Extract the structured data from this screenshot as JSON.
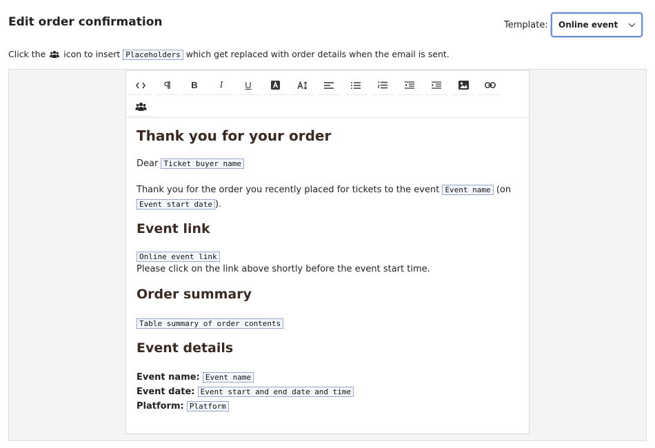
{
  "header": {
    "title": "Edit order confirmation",
    "template_label": "Template:",
    "template_value": "Online event"
  },
  "helper": {
    "prefix": "Click the",
    "middle": "icon to insert",
    "placeholders_tag": "Placeholders",
    "suffix": "which get replaced with order details when the email is sent.",
    "icon": "people-icon"
  },
  "toolbar": {
    "buttons": [
      {
        "name": "source-code",
        "icon": "code-icon"
      },
      {
        "name": "paragraph",
        "icon": "pilcrow-icon"
      },
      {
        "name": "bold",
        "icon": "bold-icon"
      },
      {
        "name": "italic",
        "icon": "italic-icon"
      },
      {
        "name": "underline",
        "icon": "underline-icon"
      },
      {
        "name": "text-color",
        "icon": "text-color-icon"
      },
      {
        "name": "font-size",
        "icon": "font-size-icon"
      },
      {
        "name": "align",
        "icon": "align-left-icon"
      },
      {
        "name": "bullet-list",
        "icon": "bullet-list-icon"
      },
      {
        "name": "numbered-list",
        "icon": "numbered-list-icon"
      },
      {
        "name": "outdent",
        "icon": "outdent-icon"
      },
      {
        "name": "indent",
        "icon": "indent-icon"
      },
      {
        "name": "image",
        "icon": "image-icon"
      },
      {
        "name": "link",
        "icon": "link-icon"
      },
      {
        "name": "placeholders",
        "icon": "people-icon"
      }
    ]
  },
  "body": {
    "heading1": "Thank you for your order",
    "dear": "Dear",
    "ph_buyer": "Ticket buyer name",
    "thanks_text": "Thank you for the order you recently placed for tickets to the event",
    "ph_event_name": "Event name",
    "on_open": "(on",
    "ph_event_start": "Event start date",
    "close_paren": ").",
    "heading_link": "Event link",
    "ph_online_link": "Online event link",
    "click_text": "Please click on the link above shortly before the event start time.",
    "heading_summary": "Order summary",
    "ph_table_summary": "Table summary of order contents",
    "heading_details": "Event details",
    "label_event_name": "Event name:",
    "ph_event_name2": "Event name",
    "label_event_date": "Event date:",
    "ph_event_dates": "Event start and end date and time",
    "label_platform": "Platform:",
    "ph_platform": "Platform"
  },
  "colors": {
    "placeholder_border": "#3b5bb5",
    "heading": "#3a2a22",
    "select_border": "#6b8fd6"
  }
}
